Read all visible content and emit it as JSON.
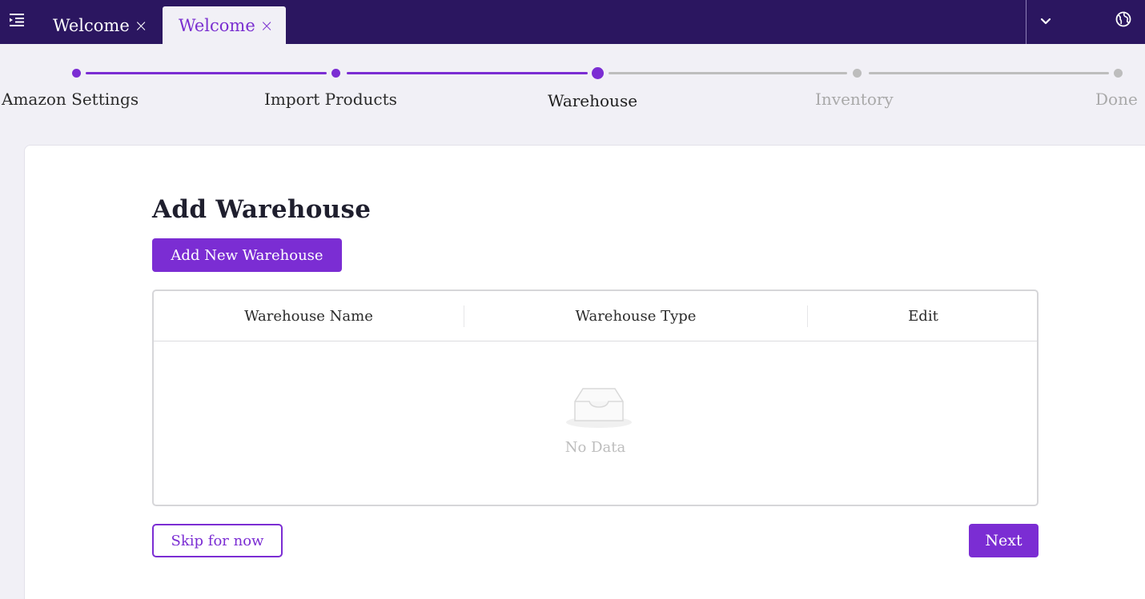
{
  "tabs": [
    {
      "label": "Welcome",
      "active": false
    },
    {
      "label": "Welcome",
      "active": true
    }
  ],
  "tab_close_glyph": "×",
  "icons": {
    "menu": "menu-fold-icon",
    "dropdown": "chevron-down-icon",
    "language": "globe-icon",
    "empty": "empty-inbox-icon"
  },
  "stepper": {
    "steps": [
      {
        "label": "Amazon Settings",
        "state": "completed"
      },
      {
        "label": "Import Products",
        "state": "completed"
      },
      {
        "label": "Warehouse",
        "state": "active"
      },
      {
        "label": "Inventory",
        "state": "pending"
      },
      {
        "label": "Done",
        "state": "pending"
      }
    ]
  },
  "main": {
    "title": "Add Warehouse",
    "add_button": "Add New Warehouse",
    "table": {
      "columns": [
        "Warehouse Name",
        "Warehouse Type",
        "Edit"
      ],
      "rows": [],
      "empty_text": "No Data"
    },
    "skip_button": "Skip for now",
    "next_button": "Next"
  },
  "colors": {
    "topbar": "#2b1660",
    "accent": "#7b2dd3",
    "pending": "#bdbdbd",
    "background": "#f1f0f6"
  }
}
